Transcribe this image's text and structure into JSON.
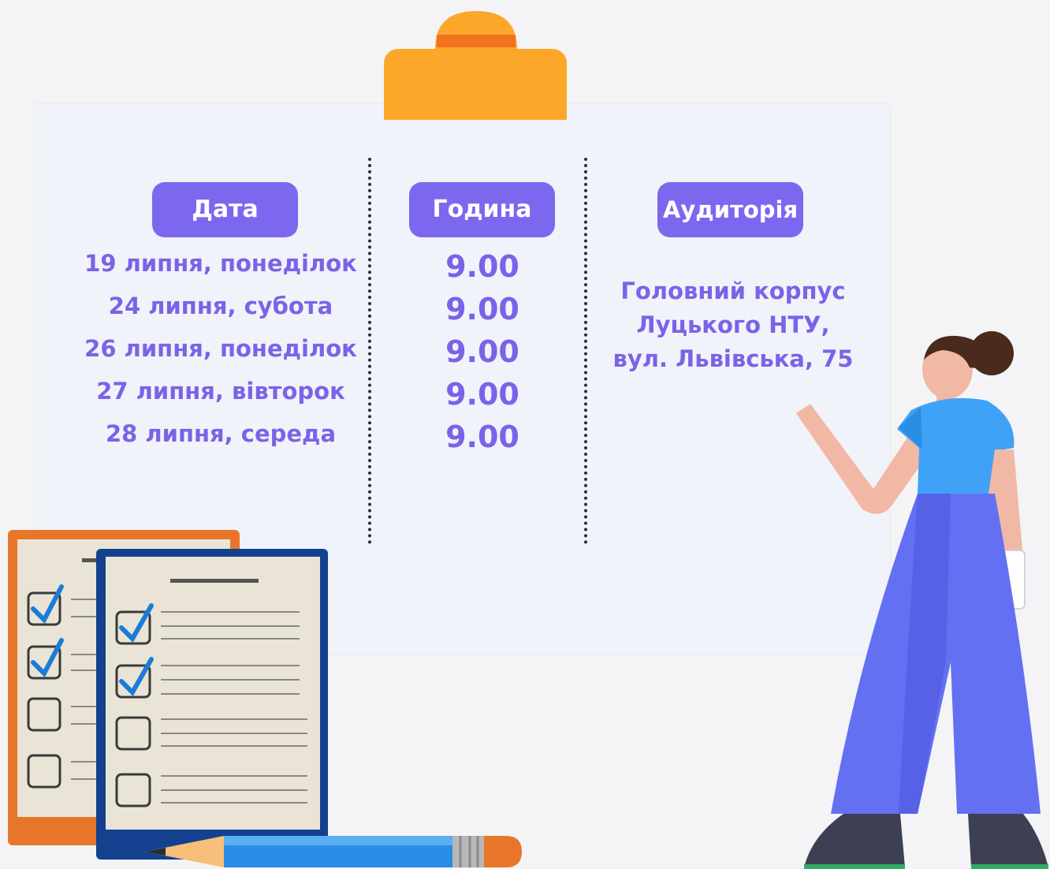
{
  "schedule": {
    "headers": {
      "date": "Дата",
      "time": "Година",
      "room": "Аудиторія"
    },
    "rows": [
      {
        "date": "19 липня, понеділок",
        "time": "9.00"
      },
      {
        "date": "24 липня, субота",
        "time": "9.00"
      },
      {
        "date": "26 липня, понеділок",
        "time": "9.00"
      },
      {
        "date": "27 липня, вівторок",
        "time": "9.00"
      },
      {
        "date": "28 липня, середа",
        "time": "9.00"
      }
    ],
    "location": [
      "Головний корпус",
      "Луцького НТУ,",
      "вул. Львівська, 75"
    ]
  },
  "colors": {
    "accent": "#7c68ef",
    "text": "#7a63e8",
    "clip": "#fca72a",
    "board": "#f0f3f9"
  },
  "illustration": {
    "icons": [
      "clipboard-clip-icon",
      "checklist-icon",
      "pencil-icon",
      "teacher-figure"
    ]
  }
}
